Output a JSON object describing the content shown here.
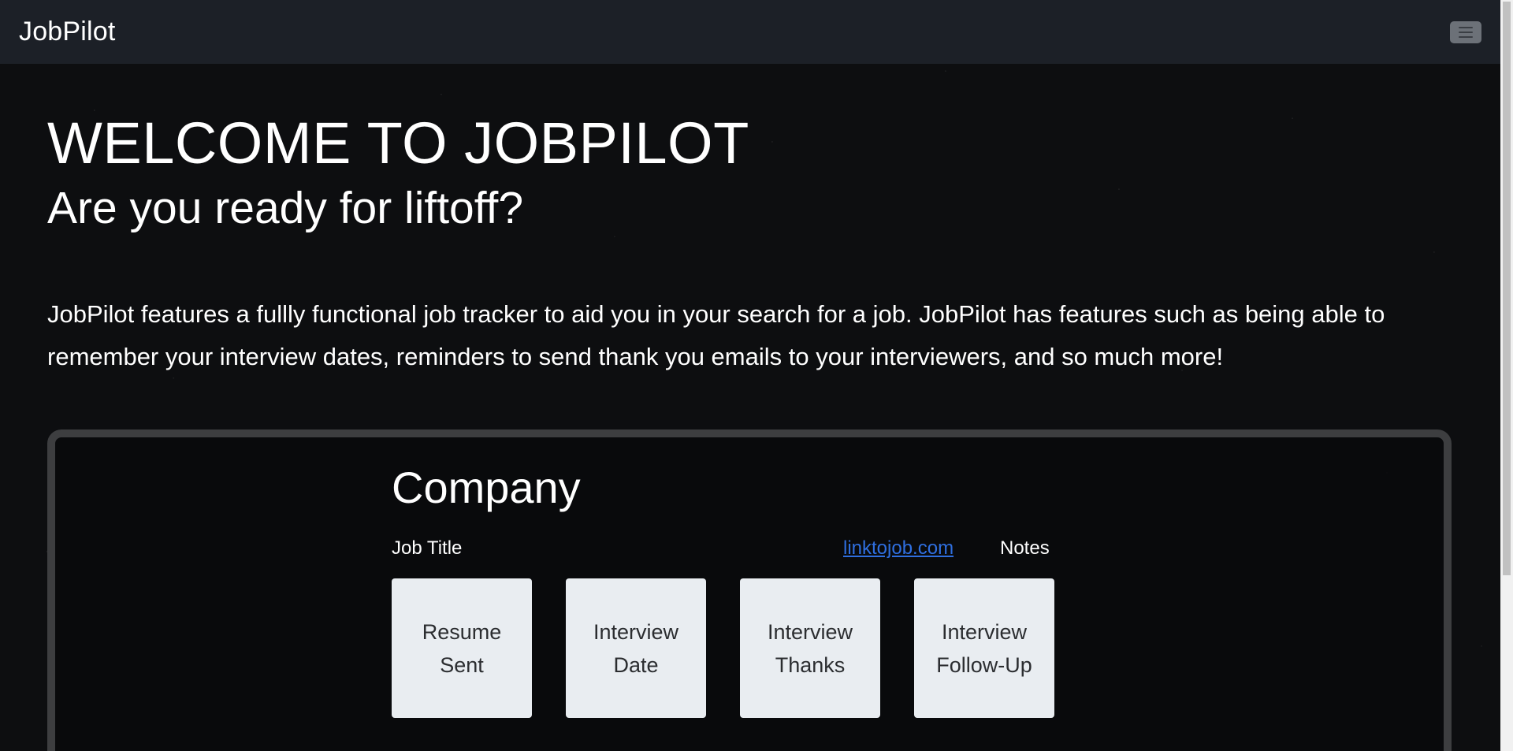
{
  "navbar": {
    "brand": "JobPilot",
    "toggler_icon": "hamburger-icon"
  },
  "hero": {
    "heading": "WELCOME TO JOBPILOT",
    "subheading": "Are you ready for liftoff?",
    "intro": "JobPilot features a fullly functional job tracker to aid you in your search for a job. JobPilot has features such as being able to remember your interview dates, reminders to send thank you emails to your interviewers, and so much more!"
  },
  "preview": {
    "company": "Company",
    "job_title": "Job Title",
    "link_text": "linktojob.com",
    "notes": "Notes",
    "steps": [
      {
        "line1": "Resume",
        "line2": "Sent"
      },
      {
        "line1": "Interview",
        "line2": "Date"
      },
      {
        "line1": "Interview",
        "line2": "Thanks"
      },
      {
        "line1": "Interview",
        "line2": "Follow-Up"
      }
    ]
  },
  "colors": {
    "navbar_bg": "#1c2027",
    "page_bg": "#0d0e10",
    "link": "#2f6fe0",
    "step_bg": "#e9edf1",
    "panel_border": "#3d3e40"
  }
}
